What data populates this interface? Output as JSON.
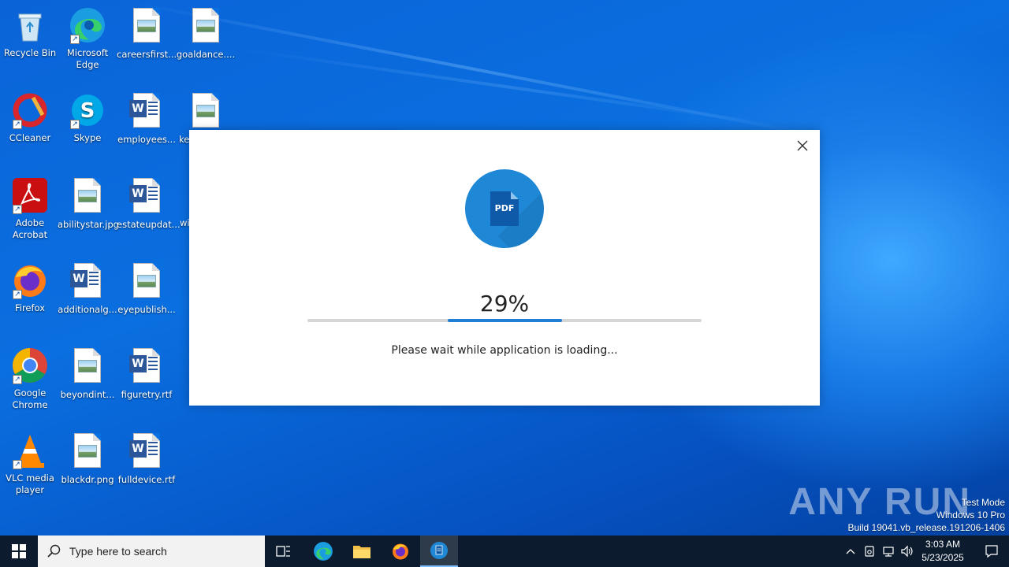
{
  "desktop": {
    "icons": [
      {
        "label": "Recycle Bin"
      },
      {
        "label": "Microsoft Edge"
      },
      {
        "label": "careersfirst..."
      },
      {
        "label": "goaldance...."
      },
      {
        "label": "CCleaner"
      },
      {
        "label": "Skype"
      },
      {
        "label": "employees..."
      },
      {
        "label": "ke"
      },
      {
        "label": "Adobe Acrobat"
      },
      {
        "label": "abilitystar.jpg"
      },
      {
        "label": "estateupdat..."
      },
      {
        "label": "wi"
      },
      {
        "label": "Firefox"
      },
      {
        "label": "additionalg..."
      },
      {
        "label": "eyepublish..."
      },
      {
        "label": "Google Chrome"
      },
      {
        "label": "beyondint..."
      },
      {
        "label": "figuretry.rtf"
      },
      {
        "label": "VLC media player"
      },
      {
        "label": "blackdr.png"
      },
      {
        "label": "fulldevice.rtf"
      }
    ]
  },
  "dialog": {
    "icon_text": "PDF",
    "percent_label": "29%",
    "progress_fraction": 0.29,
    "message": "Please wait while application is loading..."
  },
  "watermark": {
    "brand": "ANY RUN",
    "line1": "Test Mode",
    "line2": "Windows 10 Pro",
    "line3": "Build 19041.vb_release.191206-1406"
  },
  "taskbar": {
    "search_placeholder": "Type here to search",
    "time": "3:03 AM",
    "date": "5/23/2025"
  },
  "colors": {
    "accent": "#1e7fd4",
    "taskbar": "#0c1b2e",
    "desktop": "#0a6fe0"
  }
}
